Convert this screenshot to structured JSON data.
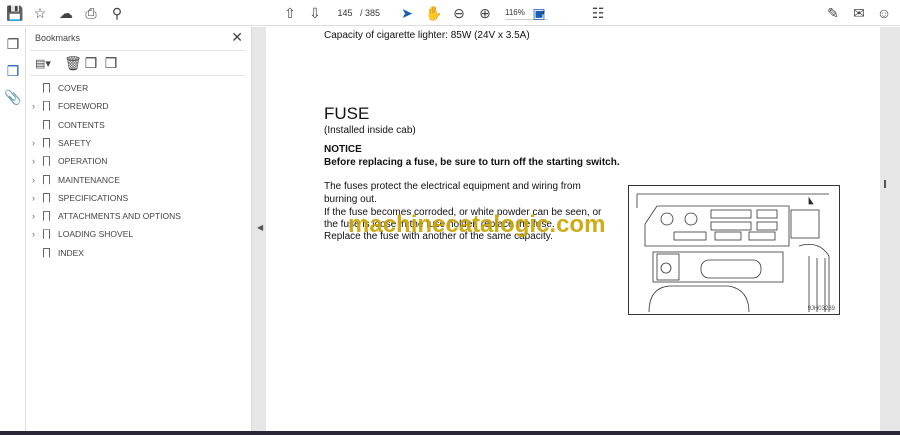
{
  "toolbar": {
    "page_current": "145",
    "page_total": "/ 385",
    "zoom": "116%"
  },
  "panel": {
    "title": "Bookmarks",
    "items": [
      {
        "label": "COVER",
        "expandable": false
      },
      {
        "label": "FOREWORD",
        "expandable": true
      },
      {
        "label": "CONTENTS",
        "expandable": false
      },
      {
        "label": "SAFETY",
        "expandable": true
      },
      {
        "label": "OPERATION",
        "expandable": true
      },
      {
        "label": "MAINTENANCE",
        "expandable": true
      },
      {
        "label": "SPECIFICATIONS",
        "expandable": true
      },
      {
        "label": "ATTACHMENTS AND OPTIONS",
        "expandable": true
      },
      {
        "label": "LOADING SHOVEL",
        "expandable": true
      },
      {
        "label": "INDEX",
        "expandable": false
      }
    ]
  },
  "document": {
    "capacity_line": "Capacity of cigarette lighter:  85W (24V x 3.5A)",
    "heading": "FUSE",
    "subheading": "(Installed inside cab)",
    "notice_label": "NOTICE",
    "notice_text": "Before replacing a fuse, be sure to turn off the starting switch.",
    "para": [
      "The fuses protect the electrical equipment and wiring from",
      "burning out.",
      "If the fuse becomes corroded, or white powder can be seen, or",
      "the fuse is loose in the fuse holder, replace the fuse.",
      "Replace the fuse with another of the same capacity."
    ],
    "figure_code": "9JH03239",
    "watermark": "machinecatalogic.com"
  }
}
